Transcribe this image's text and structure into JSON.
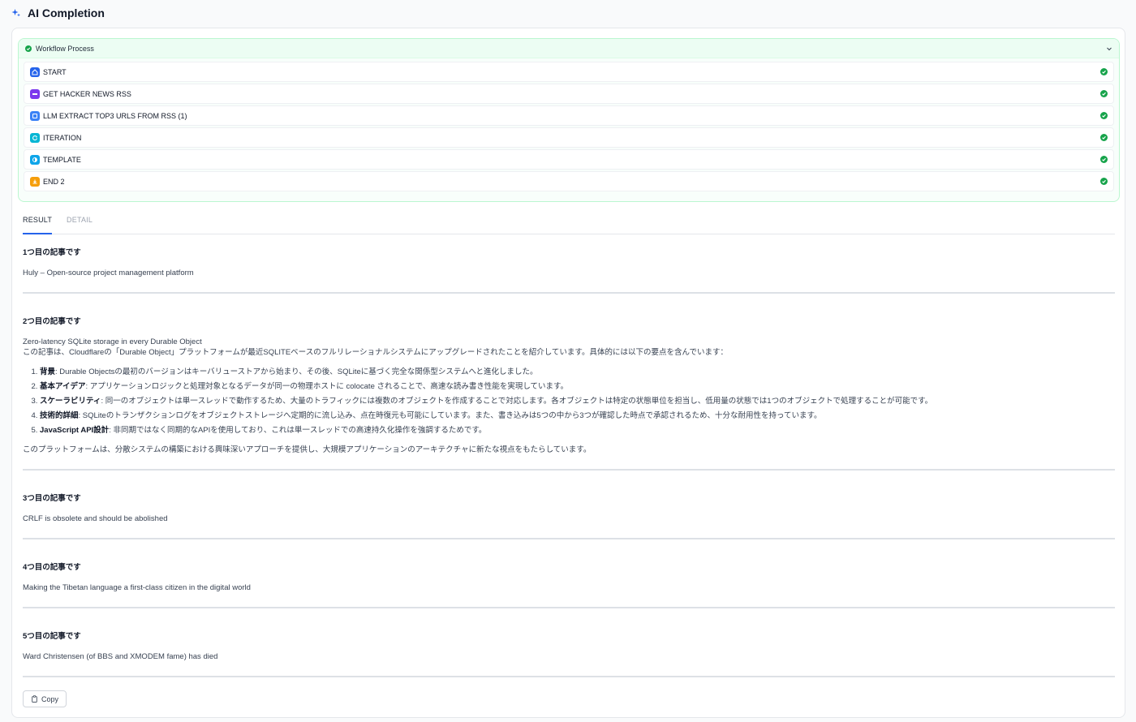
{
  "header": {
    "title": "AI Completion",
    "icon": "sparkle-icon"
  },
  "workflow": {
    "title": "Workflow Process",
    "status_color": "#16a34a",
    "nodes": [
      {
        "label": "START",
        "icon": "home-icon",
        "color": "#2563eb"
      },
      {
        "label": "GET HACKER NEWS RSS",
        "icon": "http-icon",
        "color": "#7c3aed"
      },
      {
        "label": "LLM EXTRACT TOP3 URLS FROM RSS (1)",
        "icon": "llm-icon",
        "color": "#3b82f6"
      },
      {
        "label": "ITERATION",
        "icon": "iteration-icon",
        "color": "#06b6d4"
      },
      {
        "label": "TEMPLATE",
        "icon": "template-icon",
        "color": "#0ea5e9"
      },
      {
        "label": "END 2",
        "icon": "end-icon",
        "color": "#f59e0b"
      }
    ]
  },
  "tabs": [
    {
      "label": "RESULT",
      "active": true
    },
    {
      "label": "DETAIL",
      "active": false
    }
  ],
  "result": {
    "articles": [
      {
        "heading": "1つ目の記事です",
        "title": "Huly – Open-source project management platform"
      },
      {
        "heading": "2つ目の記事です",
        "title": "Zero-latency SQLite storage in every Durable Object",
        "intro": "この記事は、Cloudflareの「Durable Object」プラットフォームが最近SQLITEベースのフルリレーショナルシステムにアップグレードされたことを紹介しています。具体的には以下の要点を含んでいます：",
        "points": [
          {
            "term": "背景",
            "text": ": Durable Objectsの最初のバージョンはキーバリューストアから始まり、その後、SQLiteに基づく完全な関係型システムへと進化しました。"
          },
          {
            "term": "基本アイデア",
            "text": ": アプリケーションロジックと処理対象となるデータが同一の物理ホストに colocate されることで、高速な読み書き性能を実現しています。"
          },
          {
            "term": "スケーラビリティ",
            "text": ": 同一のオブジェクトは単一スレッドで動作するため、大量のトラフィックには複数のオブジェクトを作成することで対応します。各オブジェクトは特定の状態単位を担当し、低用量の状態では1つのオブジェクトで処理することが可能です。"
          },
          {
            "term": "技術的詳細",
            "text": ": SQLiteのトランザクションログをオブジェクトストレージへ定期的に流し込み、点在時復元も可能にしています。また、書き込みは5つの中から3つが確認した時点で承認されるため、十分な耐用性を持っています。"
          },
          {
            "term": "JavaScript API設計",
            "text": ": 非同期ではなく同期的なAPIを使用しており、これは単一スレッドでの高速持久化操作を強調するためです。"
          }
        ],
        "closing": "このプラットフォームは、分散システムの構築における興味深いアプローチを提供し、大規模アプリケーションのアーキテクチャに新たな視点をもたらしています。"
      },
      {
        "heading": "3つ目の記事です",
        "title": "CRLF is obsolete and should be abolished"
      },
      {
        "heading": "4つ目の記事です",
        "title": "Making the Tibetan language a first-class citizen in the digital world"
      },
      {
        "heading": "5つ目の記事です",
        "title": "Ward Christensen (of BBS and XMODEM fame) has died"
      }
    ]
  },
  "copy_button": {
    "label": "Copy"
  }
}
